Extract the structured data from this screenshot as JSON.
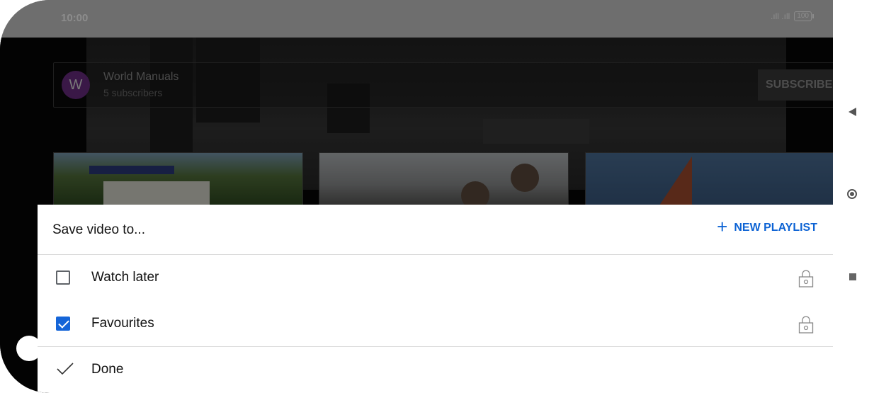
{
  "status_bar": {
    "time": "10:00",
    "signal": ".ıll .ıll",
    "battery": "100"
  },
  "channel": {
    "avatar_letter": "W",
    "name": "World Manuals",
    "subscribers": "5 subscribers",
    "subscribe_label": "SUBSCRIBE"
  },
  "sheet": {
    "title": "Save video to...",
    "new_playlist_label": "NEW PLAYLIST",
    "playlists": [
      {
        "label": "Watch later",
        "checked": false,
        "icon": "lock-icon"
      },
      {
        "label": "Favourites",
        "checked": true,
        "icon": "lock-icon"
      }
    ],
    "done_label": "Done"
  },
  "nav": {
    "back_icon": "back-triangle-icon",
    "home_icon": "home-circle-icon",
    "recents_icon": "recents-square-icon"
  },
  "colors": {
    "accent": "#0d63d4",
    "checkbox_checked": "#1565d8",
    "avatar": "#6a2d82"
  }
}
